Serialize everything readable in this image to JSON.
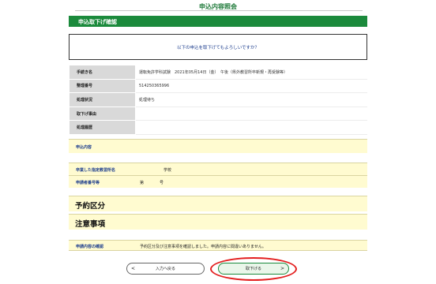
{
  "header": {
    "title": "申込内容照会"
  },
  "section": {
    "title": "申込取下げ確認"
  },
  "confirm": {
    "message": "以下の申込を取下げてもよろしいですか？"
  },
  "info_rows": [
    {
      "label": "手続き名",
      "value": "運転免許学科試験　2021年05月14日（金）　午後（県外教習所卒新規・再受験等）"
    },
    {
      "label": "整理番号",
      "value": "514250365996"
    },
    {
      "label": "処理状況",
      "value": "処理待ち"
    },
    {
      "label": "取下げ事由",
      "value": ""
    },
    {
      "label": "処理履歴",
      "value": ""
    }
  ],
  "application": {
    "heading": "申込内容",
    "school_label": "卒業した指定教習所名",
    "school_value": "学校",
    "number_label": "申請者番号等",
    "number_prefix": "第",
    "number_suffix": "号"
  },
  "reservation": {
    "heading": "予約区分"
  },
  "notes": {
    "heading": "注意事項"
  },
  "confirmation": {
    "label": "申請内容の確認",
    "value": "予約区分及び注意事項を確認しました。申請内容に間違いありません。"
  },
  "buttons": {
    "back_label": "入力へ戻る",
    "back_arrow": "<",
    "withdraw_label": "取下げる",
    "withdraw_arrow": ">"
  }
}
